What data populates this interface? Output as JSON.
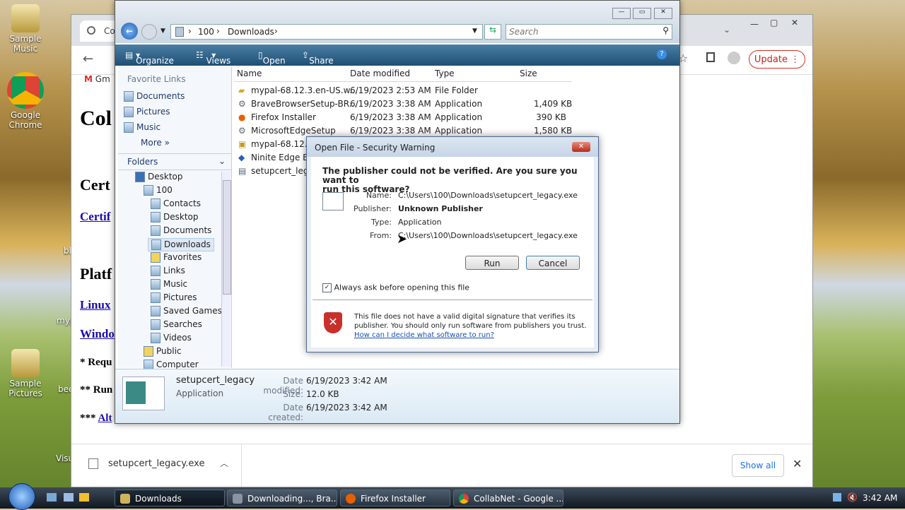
{
  "desktop": {
    "icons": [
      {
        "label_line1": "Sample",
        "label_line2": "Music"
      },
      {
        "label_line1": "Google",
        "label_line2": "Chrome"
      },
      {
        "label_line1": "Sample",
        "label_line2": "Pictures"
      }
    ],
    "partial_labels": [
      "bl",
      "myp",
      "bee",
      "Visu"
    ]
  },
  "chrome": {
    "tab_partial": "Co",
    "bookmark_partial": "Gm",
    "update_label": "Update",
    "page": {
      "heading_partial": "Col",
      "cert_heading_partial": "Cert",
      "cert_link_partial": "Certif",
      "platform_heading_partial": "Platf",
      "linux_link_partial": "Linux",
      "windows_link_partial": "Windo",
      "note1_partial": "* Requ",
      "note2_partial": "** Run",
      "note3_prefix": "*** ",
      "note3_link_partial": "Alt"
    },
    "download_bar": {
      "file": "setupcert_legacy.exe",
      "show_all": "Show all"
    }
  },
  "explorer": {
    "breadcrumb": [
      "100",
      "Downloads"
    ],
    "search_placeholder": "Search",
    "commands": [
      "Organize",
      "Views",
      "Open",
      "Share"
    ],
    "favorite_links_header": "Favorite Links",
    "favorite_links": [
      "Documents",
      "Pictures",
      "Music"
    ],
    "more_label": "More",
    "folders_header": "Folders",
    "tree": [
      "Desktop",
      "100",
      "Contacts",
      "Desktop",
      "Documents",
      "Downloads",
      "Favorites",
      "Links",
      "Music",
      "Pictures",
      "Saved Games",
      "Searches",
      "Videos",
      "Public",
      "Computer"
    ],
    "columns": [
      "Name",
      "Date modified",
      "Type",
      "Size"
    ],
    "files": [
      {
        "name": "mypal-68.12.3.en-US.w...",
        "date": "6/19/2023 2:53 AM",
        "type": "File Folder",
        "size": ""
      },
      {
        "name": "BraveBrowserSetup-BR...",
        "date": "6/19/2023 3:38 AM",
        "type": "Application",
        "size": "1,409 KB"
      },
      {
        "name": "Firefox Installer",
        "date": "6/19/2023 3:38 AM",
        "type": "Application",
        "size": "390 KB"
      },
      {
        "name": "MicrosoftEdgeSetup",
        "date": "6/19/2023 3:38 AM",
        "type": "Application",
        "size": "1,580 KB"
      },
      {
        "name": "mypal-68.12.3.",
        "date": "",
        "type": "",
        "size": ""
      },
      {
        "name": "Ninite Edge Eve",
        "date": "",
        "type": "",
        "size": ""
      },
      {
        "name": "setupcert_legac",
        "date": "",
        "type": "",
        "size": ""
      }
    ],
    "details": {
      "name": "setupcert_legacy",
      "kind": "Application",
      "date_modified_label": "Date modified:",
      "date_modified": "6/19/2023 3:42 AM",
      "size_label": "Size:",
      "size": "12.0 KB",
      "date_created_label": "Date created:",
      "date_created": "6/19/2023 3:42 AM"
    }
  },
  "dialog": {
    "title": "Open File - Security Warning",
    "question_line1": "The publisher could not be verified.  Are you sure you want to",
    "question_line2": "run this software?",
    "name_label": "Name:",
    "name_value": "C:\\Users\\100\\Downloads\\setupcert_legacy.exe",
    "publisher_label": "Publisher:",
    "publisher_value": "Unknown Publisher",
    "type_label": "Type:",
    "type_value": "Application",
    "from_label": "From:",
    "from_value": "C:\\Users\\100\\Downloads\\setupcert_legacy.exe",
    "run_label": "Run",
    "cancel_label": "Cancel",
    "checkbox_label": "Always ask before opening this file",
    "warning_line1": "This file does not have a valid digital signature that verifies its",
    "warning_line2": "publisher.  You should only run software from publishers you trust.",
    "warning_link": "How can I decide what software to run?"
  },
  "taskbar": {
    "tasks": [
      "Downloads",
      "Downloading..., Bra...",
      "Firefox Installer",
      "CollabNet - Google ..."
    ],
    "clock": "3:42 AM"
  }
}
